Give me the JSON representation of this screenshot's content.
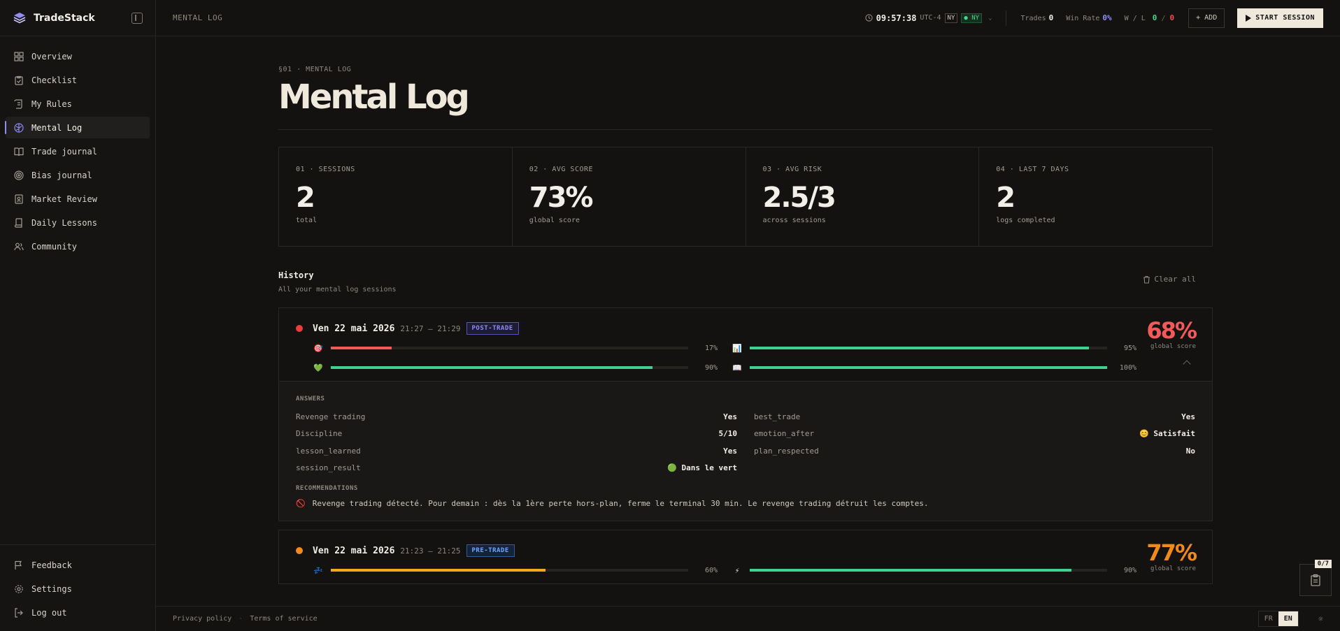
{
  "brand": {
    "name": "TradeStack"
  },
  "sidebar": {
    "items": [
      {
        "label": "Overview",
        "icon": "grid-icon"
      },
      {
        "label": "Checklist",
        "icon": "clipboard-check-icon"
      },
      {
        "label": "My Rules",
        "icon": "scroll-icon"
      },
      {
        "label": "Mental Log",
        "icon": "brain-icon",
        "active": true
      },
      {
        "label": "Trade journal",
        "icon": "book-open-icon"
      },
      {
        "label": "Bias journal",
        "icon": "target-icon"
      },
      {
        "label": "Market Review",
        "icon": "contact-book-icon"
      },
      {
        "label": "Daily Lessons",
        "icon": "notebook-icon"
      },
      {
        "label": "Community",
        "icon": "users-icon"
      }
    ],
    "bottom": [
      {
        "label": "Feedback",
        "icon": "flag-icon"
      },
      {
        "label": "Settings",
        "icon": "gear-icon"
      },
      {
        "label": "Log out",
        "icon": "logout-icon"
      }
    ]
  },
  "topbar": {
    "breadcrumb": "MENTAL LOG",
    "time": "09:57:38",
    "timezone": "UTC-4",
    "market_tag": "NY",
    "market_status": "● NY",
    "trades_label": "Trades",
    "trades_value": "0",
    "winrate_label": "Win Rate",
    "winrate_value": "0%",
    "wl_label": "W / L",
    "wins": "0",
    "losses": "0",
    "add_label": "+ ADD",
    "start_label": "START SESSION"
  },
  "page": {
    "section_tag": "§01 · MENTAL LOG",
    "title": "Mental Log"
  },
  "stats": [
    {
      "label": "01 · SESSIONS",
      "value": "2",
      "sub": "total"
    },
    {
      "label": "02 · AVG SCORE",
      "value": "73%",
      "sub": "global score"
    },
    {
      "label": "03 · AVG RISK",
      "value": "2.5/3",
      "sub": "across sessions"
    },
    {
      "label": "04 · LAST 7 DAYS",
      "value": "2",
      "sub": "logs completed"
    }
  ],
  "history": {
    "title": "History",
    "subtitle": "All your mental log sessions",
    "clear_label": "Clear all"
  },
  "sessions": [
    {
      "date": "Ven 22 mai 2026",
      "time": "21:27 – 21:29",
      "badge": "POST-TRADE",
      "dot_color": "#ee3b3b",
      "score": "68%",
      "score_label": "global score",
      "score_color": "#f25a5a",
      "bars": [
        {
          "icon": "🎯",
          "pct_label": "17%",
          "value": 17,
          "color": "#ee5a5a"
        },
        {
          "icon": "📊",
          "pct_label": "95%",
          "value": 95,
          "color": "#3fd18f"
        },
        {
          "icon": "💚",
          "pct_label": "90%",
          "value": 90,
          "color": "#3fd18f"
        },
        {
          "icon": "📖",
          "pct_label": "100%",
          "value": 100,
          "color": "#3fd18f"
        }
      ],
      "answers_title": "ANSWERS",
      "answers": [
        {
          "key": "Revenge trading",
          "value": "Yes"
        },
        {
          "key": "best_trade",
          "value": "Yes"
        },
        {
          "key": "Discipline",
          "value": "5/10"
        },
        {
          "key": "emotion_after",
          "value": "😊 Satisfait"
        },
        {
          "key": "lesson_learned",
          "value": "Yes"
        },
        {
          "key": "plan_respected",
          "value": "No"
        },
        {
          "key": "session_result",
          "value": "🟢 Dans le vert"
        }
      ],
      "recommendations_title": "RECOMMENDATIONS",
      "recommendation_icon": "🚫",
      "recommendation": "Revenge trading détecté. Pour demain : dès la 1ère perte hors-plan, ferme le terminal 30 min. Le revenge trading détruit les comptes."
    },
    {
      "date": "Ven 22 mai 2026",
      "time": "21:23 – 21:25",
      "badge": "PRE-TRADE",
      "dot_color": "#f28a1a",
      "score": "77%",
      "score_label": "global score",
      "score_color": "#f28a1a",
      "bars": [
        {
          "icon": "💤",
          "pct_label": "60%",
          "value": 60,
          "color": "#f2a91a"
        },
        {
          "icon": "⚡",
          "pct_label": "90%",
          "value": 90,
          "color": "#3fd18f"
        }
      ]
    }
  ],
  "footer": {
    "privacy": "Privacy policy",
    "separator": "·",
    "terms": "Terms of service",
    "lang_fr": "FR",
    "lang_en": "EN"
  },
  "float_checklist": {
    "count": "0/7"
  },
  "colors": {
    "accent": "#8f8cf5",
    "green": "#3fd18f",
    "red": "#ee3b3b",
    "orange": "#f28a1a",
    "bg": "#131211"
  }
}
